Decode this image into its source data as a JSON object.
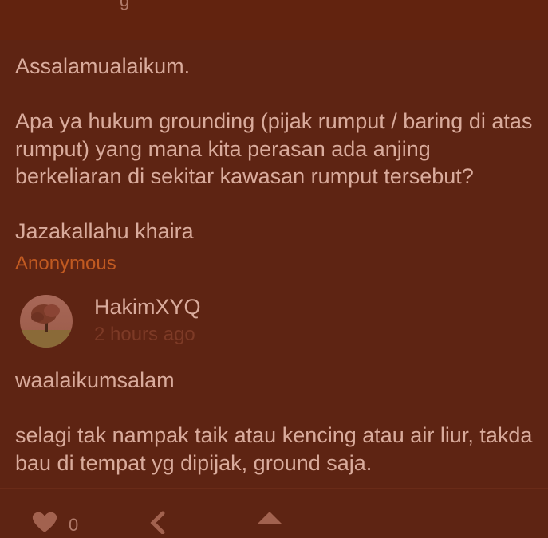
{
  "post": {
    "greeting": "Assalamualaikum.",
    "question": "Apa ya hukum grounding (pijak rumput / baring di atas rumput) yang mana kita perasan ada anjing berkeliaran di sekitar kawasan rumput tersebut?",
    "closing": "Jazakallahu khaira",
    "author": "Anonymous"
  },
  "reply": {
    "username": "HakimXYQ",
    "timestamp": "2 hours ago",
    "line1": "waalaikumsalam",
    "line2": "selagi tak nampak taik atau kencing atau air liur, takda bau di tempat yg dipijak, ground saja."
  },
  "actions": {
    "like_count": "0"
  },
  "icons": [
    "heart-icon",
    "reply-arrow-icon",
    "upvote-icon"
  ],
  "colors": {
    "background": "#5e2413",
    "text": "#d9ab9c",
    "accent": "#c15a21",
    "muted": "#7d3a26"
  }
}
